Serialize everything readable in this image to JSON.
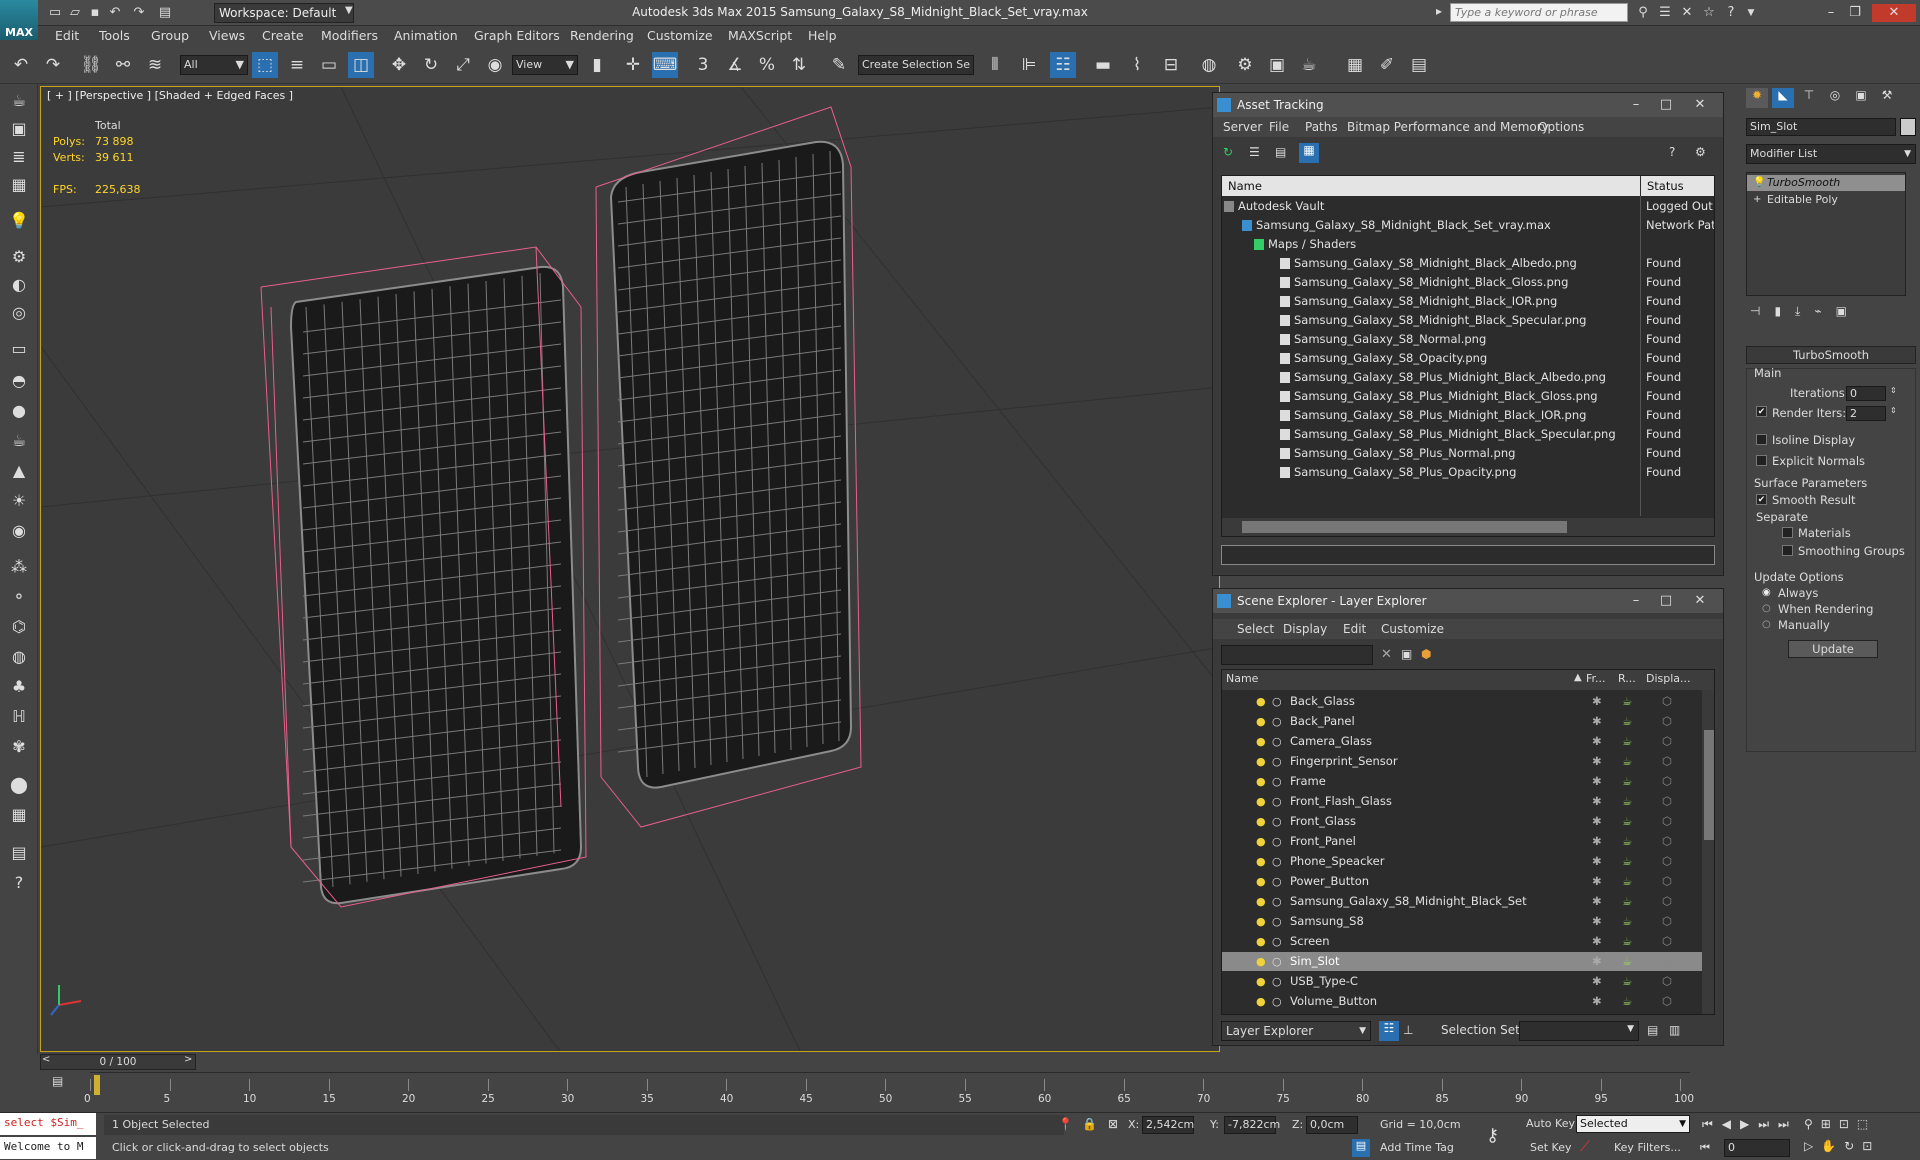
{
  "app": {
    "logo": "MAX",
    "workspace": "Workspace: Default",
    "title": "Autodesk 3ds Max  2015    Samsung_Galaxy_S8_Midnight_Black_Set_vray.max",
    "search_placeholder": "Type a keyword or phrase"
  },
  "menu": [
    "Edit",
    "Tools",
    "Group",
    "Views",
    "Create",
    "Modifiers",
    "Animation",
    "Graph Editors",
    "Rendering",
    "Customize",
    "MAXScript",
    "Help"
  ],
  "toolbar": {
    "selection_filter": "All",
    "ref_coord": "View",
    "named_selection": "Create Selection Se",
    "snap_labels": [
      "3",
      "%",
      "%"
    ]
  },
  "viewport": {
    "label": "[ + ] [Perspective ] [Shaded + Edged Faces ]",
    "stats_header": "Total",
    "polys_label": "Polys:",
    "polys_value": "73 898",
    "verts_label": "Verts:",
    "verts_value": "39 611",
    "fps_label": "FPS:",
    "fps_value": "225,638",
    "accent_color": "#c8a21a",
    "wire_color": "#8c8c8c",
    "bbox_color": "#e8608a"
  },
  "asset_tracking": {
    "title": "Asset Tracking",
    "menu": [
      "Server",
      "File",
      "Paths",
      "Bitmap Performance and Memory",
      "Options"
    ],
    "col_name": "Name",
    "col_status": "Status",
    "rows": [
      {
        "name": "Autodesk Vault",
        "status": "Logged Out"
      },
      {
        "name": "Samsung_Galaxy_S8_Midnight_Black_Set_vray.max",
        "status": "Network Path"
      },
      {
        "name": "Maps / Shaders",
        "status": ""
      },
      {
        "name": "Samsung_Galaxy_S8_Midnight_Black_Albedo.png",
        "status": "Found"
      },
      {
        "name": "Samsung_Galaxy_S8_Midnight_Black_Gloss.png",
        "status": "Found"
      },
      {
        "name": "Samsung_Galaxy_S8_Midnight_Black_IOR.png",
        "status": "Found"
      },
      {
        "name": "Samsung_Galaxy_S8_Midnight_Black_Specular.png",
        "status": "Found"
      },
      {
        "name": "Samsung_Galaxy_S8_Normal.png",
        "status": "Found"
      },
      {
        "name": "Samsung_Galaxy_S8_Opacity.png",
        "status": "Found"
      },
      {
        "name": "Samsung_Galaxy_S8_Plus_Midnight_Black_Albedo.png",
        "status": "Found"
      },
      {
        "name": "Samsung_Galaxy_S8_Plus_Midnight_Black_Gloss.png",
        "status": "Found"
      },
      {
        "name": "Samsung_Galaxy_S8_Plus_Midnight_Black_IOR.png",
        "status": "Found"
      },
      {
        "name": "Samsung_Galaxy_S8_Plus_Midnight_Black_Specular.png",
        "status": "Found"
      },
      {
        "name": "Samsung_Galaxy_S8_Plus_Normal.png",
        "status": "Found"
      },
      {
        "name": "Samsung_Galaxy_S8_Plus_Opacity.png",
        "status": "Found"
      }
    ]
  },
  "scene_explorer": {
    "title": "Scene Explorer - Layer Explorer",
    "menu": [
      "Select",
      "Display",
      "Edit",
      "Customize"
    ],
    "col_name": "Name",
    "col_freeze": "Fr...",
    "col_render": "R...",
    "col_display": "Displa...",
    "rows": [
      "Back_Glass",
      "Back_Panel",
      "Camera_Glass",
      "Fingerprint_Sensor",
      "Frame",
      "Front_Flash_Glass",
      "Front_Glass",
      "Front_Panel",
      "Phone_Speacker",
      "Power_Button",
      "Samsung_Galaxy_S8_Midnight_Black_Set",
      "Samsung_S8",
      "Screen",
      "Sim_Slot",
      "USB_Type-C",
      "Volume_Button"
    ],
    "selected": "Sim_Slot",
    "footer_mode": "Layer Explorer",
    "selection_set_label": "Selection Set:"
  },
  "command_panel": {
    "object_name": "Sim_Slot",
    "modifier_list": "Modifier List",
    "stack": [
      "TurboSmooth",
      "Editable Poly"
    ],
    "rollout_title": "TurboSmooth",
    "main_label": "Main",
    "iterations_label": "Iterations:",
    "iterations_value": "0",
    "render_iters_label": "Render Iters:",
    "render_iters_value": "2",
    "isoline": "Isoline Display",
    "explicit": "Explicit Normals",
    "surface_params": "Surface Parameters",
    "smooth_result": "Smooth Result",
    "separate": "Separate",
    "materials": "Materials",
    "smoothing_groups": "Smoothing Groups",
    "update_options": "Update Options",
    "always": "Always",
    "when_rendering": "When Rendering",
    "manually": "Manually",
    "update_btn": "Update"
  },
  "timeline": {
    "frame_counter": "0 / 100",
    "ticks": [
      "0",
      "5",
      "10",
      "15",
      "20",
      "25",
      "30",
      "35",
      "40",
      "45",
      "50",
      "55",
      "60",
      "65",
      "70",
      "75",
      "80",
      "85",
      "90",
      "95",
      "100"
    ]
  },
  "status": {
    "maxscript_line1": "select $Sim_",
    "maxscript_line2": "Welcome to M",
    "selected_msg": "1 Object Selected",
    "prompt_msg": "Click or click-and-drag to select objects",
    "x_label": "X:",
    "x_value": "2,542cm",
    "y_label": "Y:",
    "y_value": "-7,822cm",
    "z_label": "Z:",
    "z_value": "0,0cm",
    "grid": "Grid = 10,0cm",
    "add_time_tag": "Add Time Tag",
    "auto_key": "Auto Key",
    "set_key": "Set Key",
    "key_mode": "Selected",
    "key_filters": "Key Filters...",
    "frame_value": "0"
  }
}
